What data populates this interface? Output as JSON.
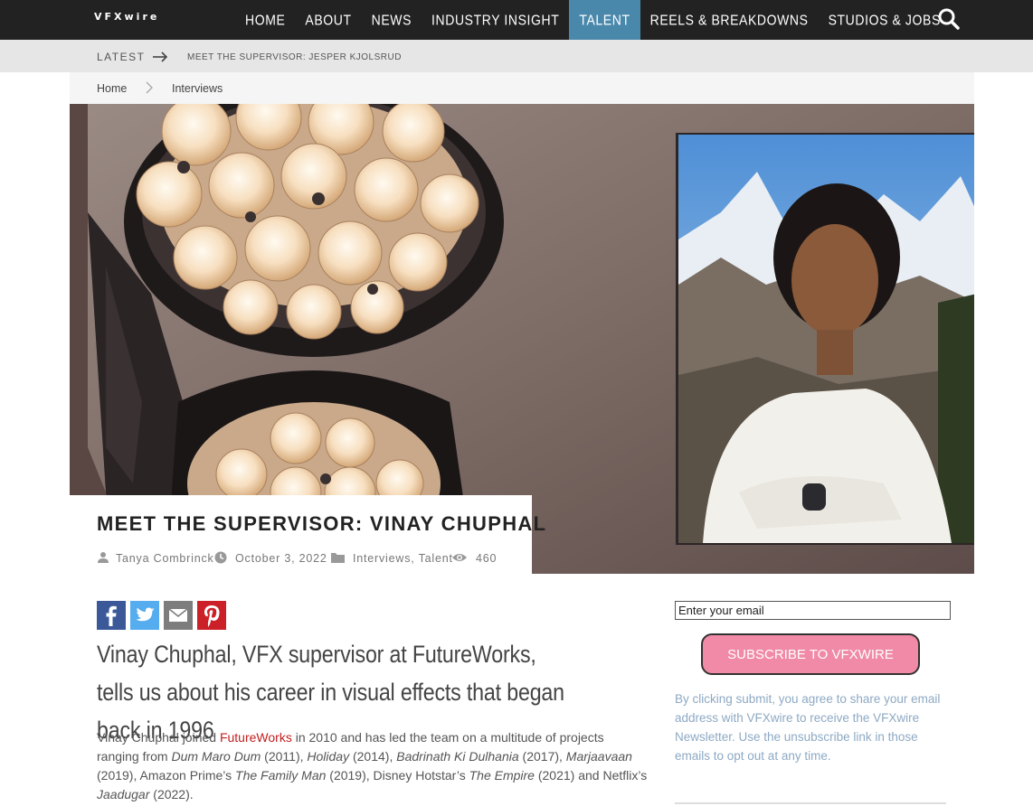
{
  "site": {
    "logo": "VFXwire"
  },
  "nav": {
    "items": [
      {
        "label": "HOME",
        "active": false
      },
      {
        "label": "ABOUT",
        "active": false
      },
      {
        "label": "NEWS",
        "active": false
      },
      {
        "label": "INDUSTRY INSIGHT",
        "active": false
      },
      {
        "label": "TALENT",
        "active": true
      },
      {
        "label": "REELS & BREAKDOWNS",
        "active": false
      },
      {
        "label": "STUDIOS & JOBS",
        "active": false
      }
    ],
    "search_icon": "search-icon"
  },
  "latest": {
    "label": "LATEST",
    "arrow_icon": "long-arrow-right-icon",
    "headline": "MEET THE SUPERVISOR: JESPER KJOLSRUD"
  },
  "breadcrumb": {
    "home": "Home",
    "separator_icon": "chevron-right-icon",
    "current": "Interviews"
  },
  "article": {
    "title": "MEET THE SUPERVISOR: VINAY CHUPHAL",
    "author": "Tanya Combrinck",
    "date": "October 3, 2022",
    "categories": "Interviews, Talent",
    "views": "460",
    "lead": "Vinay Chuphal, VFX supervisor at FutureWorks, tells us about his career in visual effects that began back in 1996",
    "body": {
      "p1_a": "Vinay Chuphal joined ",
      "p1_link": "FutureWorks",
      "p1_b": " in 2010 and has led the team on a multitude of projects ranging from ",
      "t1": "Dum Maro Dum",
      "y1": " (2011), ",
      "t2": "Holiday",
      "y2": " (2014), ",
      "t3": "Badrinath Ki Dulhania",
      "y3": " (2017), ",
      "t4": "Marjaavaan",
      "y4": " (2019), Amazon Prime’s ",
      "t5": "The Family Man",
      "y5": " (2019), Disney Hotstar’s ",
      "t6": "The Empire",
      "y6": " (2021) and Netflix’s ",
      "t7": "Jaadugar",
      "y7": " (2022)."
    }
  },
  "share": {
    "facebook": "facebook-icon",
    "twitter": "twitter-icon",
    "email": "email-icon",
    "pinterest": "pinterest-icon"
  },
  "newsletter": {
    "email_placeholder": "Enter your email",
    "subscribe_label": "SUBSCRIBE TO VFXWIRE",
    "consent": "By clicking submit, you agree to share your email address with VFXwire to receive the VFXwire Newsletter. Use the unsubscribe link in those emails to opt out at any time."
  },
  "colors": {
    "topbar": "#222222",
    "active_nav": "#4a88ab",
    "link_red": "#c21f1f",
    "subscribe_pink": "#f08aa6",
    "consent_blue": "#8da9c4",
    "facebook": "#3b5998",
    "twitter": "#55acee",
    "email": "#7d7d7d",
    "pinterest": "#cb2027"
  }
}
